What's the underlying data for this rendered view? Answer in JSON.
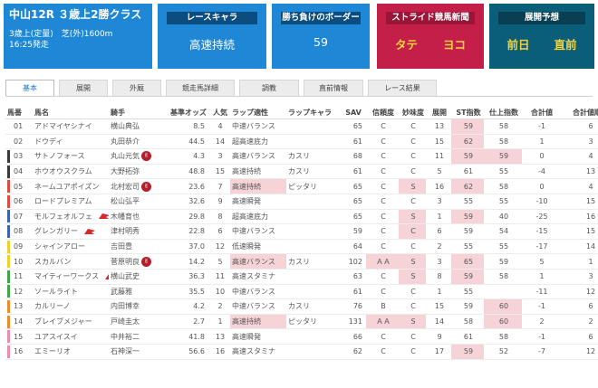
{
  "race": {
    "title": "中山12R ３歳上2勝クラス",
    "cond": "3歳上(定量)　芝(外)1600m",
    "time": "16:25発走"
  },
  "cards": {
    "chara": {
      "label": "レースキャラ",
      "value": "高速持続"
    },
    "border": {
      "label": "勝ち負けのボーダー",
      "value": "59"
    },
    "stride": {
      "label": "ストライド競馬新聞",
      "v1": "タテ",
      "v2": "ヨコ"
    },
    "forecast": {
      "label": "展開予想",
      "v1": "前日",
      "v2": "直前"
    }
  },
  "tabs": [
    "基本",
    "展開",
    "外厩",
    "競走馬詳細",
    "調教",
    "直前情報",
    "レース結果"
  ],
  "columns": [
    "馬番",
    "馬名",
    "騎手",
    "基準オッズ",
    "人気",
    "ラップ適性",
    "ラップキャラ",
    "SAV",
    "信頼度",
    "妙味度",
    "展開",
    "ST指数",
    "仕上指数",
    "合計値",
    "合計値順位"
  ],
  "rows": [
    {
      "no": "01",
      "name": "アドマイヤシナイ",
      "jockey": "横山典弘",
      "odds": "8.5",
      "pop": "4",
      "lap": "中速バランス",
      "chara": "",
      "sav": "65",
      "trust": "C",
      "value": "C",
      "dev": "13",
      "st": "59",
      "fin": "58",
      "sum": "-1",
      "rank": "6"
    },
    {
      "no": "02",
      "name": "ドウディ",
      "jockey": "丸田恭介",
      "odds": "44.5",
      "pop": "14",
      "lap": "超高速底力",
      "chara": "",
      "sav": "61",
      "trust": "C",
      "value": "C",
      "dev": "15",
      "st": "62",
      "fin": "58",
      "sum": "1",
      "rank": "3"
    },
    {
      "no": "03",
      "name": "サトノフォース",
      "jockey": "丸山元気",
      "odds": "4.3",
      "pop": "3",
      "lap": "高速バランス",
      "chara": "カスリ",
      "sav": "68",
      "trust": "C",
      "value": "C",
      "dev": "11",
      "st": "59",
      "fin": "59",
      "sum": "0",
      "rank": "4"
    },
    {
      "no": "04",
      "name": "ホウオウスクラム",
      "jockey": "大野拓弥",
      "odds": "48.8",
      "pop": "15",
      "lap": "高速持続",
      "chara": "カスリ",
      "sav": "61",
      "trust": "C",
      "value": "C",
      "dev": "5",
      "st": "61",
      "fin": "55",
      "sum": "-4",
      "rank": "13"
    },
    {
      "no": "05",
      "name": "ネームユアポイズン",
      "jockey": "北村宏司",
      "odds": "23.6",
      "pop": "7",
      "lap": "高速持続",
      "chara": "ピッタリ",
      "sav": "65",
      "trust": "C",
      "value": "S",
      "dev": "16",
      "st": "62",
      "fin": "58",
      "sum": "0",
      "rank": "4"
    },
    {
      "no": "06",
      "name": "ロードプレミアム",
      "jockey": "松山弘平",
      "odds": "32.6",
      "pop": "9",
      "lap": "高速瞬発",
      "chara": "",
      "sav": "65",
      "trust": "C",
      "value": "C",
      "dev": "3",
      "st": "55",
      "fin": "55",
      "sum": "-10",
      "rank": "15"
    },
    {
      "no": "07",
      "name": "モルフェオルフェ",
      "jockey": "木幡育也",
      "odds": "29.8",
      "pop": "8",
      "lap": "超高速底力",
      "chara": "",
      "sav": "65",
      "trust": "C",
      "value": "S",
      "dev": "1",
      "st": "59",
      "fin": "40",
      "sum": "-25",
      "rank": "16"
    },
    {
      "no": "08",
      "name": "グレンガリー",
      "jockey": "津村明秀",
      "odds": "22.8",
      "pop": "6",
      "lap": "中速バランス",
      "chara": "",
      "sav": "59",
      "trust": "C",
      "value": "C",
      "dev": "6",
      "st": "59",
      "fin": "54",
      "sum": "-15",
      "rank": "15"
    },
    {
      "no": "09",
      "name": "シャインアロー",
      "jockey": "吉田豊",
      "odds": "37.0",
      "pop": "12",
      "lap": "低速瞬発",
      "chara": "",
      "sav": "64",
      "trust": "C",
      "value": "C",
      "dev": "2",
      "st": "55",
      "fin": "55",
      "sum": "-17",
      "rank": "14"
    },
    {
      "no": "10",
      "name": "スカルバン",
      "jockey": "菅原明良",
      "odds": "14.2",
      "pop": "5",
      "lap": "高速バランス",
      "chara": "カスリ",
      "sav": "102",
      "trust": "ＡＡ",
      "value": "S",
      "dev": "3",
      "st": "65",
      "fin": "59",
      "sum": "5",
      "rank": "1"
    },
    {
      "no": "11",
      "name": "マイティーワークス",
      "jockey": "横山武史",
      "odds": "36.3",
      "pop": "11",
      "lap": "高速スタミナ",
      "chara": "",
      "sav": "63",
      "trust": "C",
      "value": "S",
      "dev": "8",
      "st": "59",
      "fin": "58",
      "sum": "1",
      "rank": "3"
    },
    {
      "no": "12",
      "name": "ソールライト",
      "jockey": "武藤雅",
      "odds": "35.5",
      "pop": "10",
      "lap": "中速バランス",
      "chara": "",
      "sav": "61",
      "trust": "C",
      "value": "C",
      "dev": "1",
      "st": "55",
      "fin": "",
      "sum": "-11",
      "rank": "12"
    },
    {
      "no": "13",
      "name": "カルリーノ",
      "jockey": "内田博幸",
      "odds": "4.2",
      "pop": "2",
      "lap": "中速バランス",
      "chara": "カスリ",
      "sav": "76",
      "trust": "B",
      "value": "C",
      "dev": "15",
      "st": "59",
      "fin": "60",
      "sum": "-1",
      "rank": "6"
    },
    {
      "no": "14",
      "name": "ブレイブメジャー",
      "jockey": "戸崎圭太",
      "odds": "2.7",
      "pop": "1",
      "lap": "高速持続",
      "chara": "ピッタリ",
      "sav": "131",
      "trust": "ＡＡ",
      "value": "S",
      "dev": "14",
      "st": "58",
      "fin": "60",
      "sum": "2",
      "rank": "2"
    },
    {
      "no": "15",
      "name": "ユアスイスイ",
      "jockey": "中井裕二",
      "odds": "41.8",
      "pop": "13",
      "lap": "高速瞬発",
      "chara": "",
      "sav": "66",
      "trust": "C",
      "value": "C",
      "dev": "9",
      "st": "61",
      "fin": "58",
      "sum": "-1",
      "rank": "6"
    },
    {
      "no": "16",
      "name": "エミーリオ",
      "jockey": "石神深一",
      "odds": "56.6",
      "pop": "16",
      "lap": "高速スタミナ",
      "chara": "",
      "sav": "62",
      "trust": "C",
      "value": "C",
      "dev": "17",
      "st": "59",
      "fin": "52",
      "sum": "-7",
      "rank": "12"
    }
  ],
  "colors": {
    "blue": "#1e88d6",
    "crimson": "#c41f48",
    "teal": "#0b5e79",
    "highlight": "#f6d3d7",
    "yellow_text": "#f5d33b"
  }
}
